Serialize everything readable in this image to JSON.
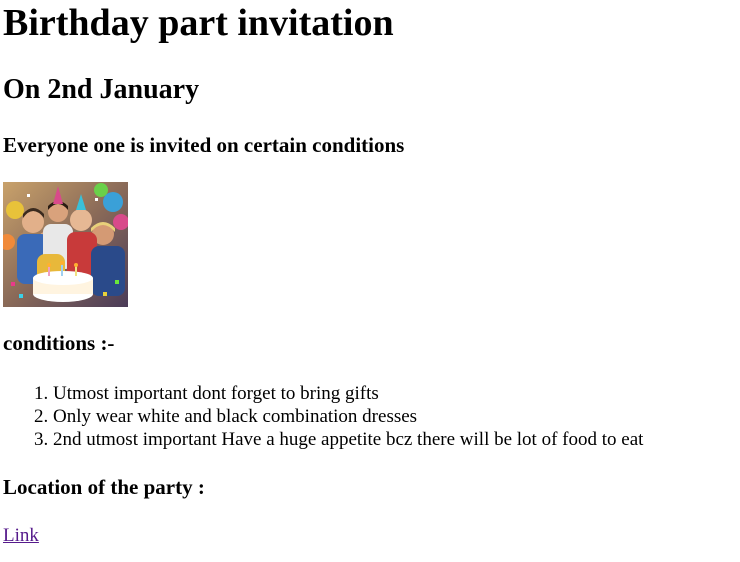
{
  "page": {
    "title": "Birthday part invitation",
    "date_heading": "On 2nd January",
    "subtitle": "Everyone one is invited on certain conditions"
  },
  "image": {
    "description_icon": "party-photo-icon"
  },
  "conditions": {
    "heading": "conditions :-",
    "items": [
      "Utmost important dont forget to bring gifts",
      "Only wear white and black combination dresses",
      "2nd utmost important Have a huge appetite bcz there will be lot of food to eat"
    ]
  },
  "location": {
    "heading": "Location of the party :",
    "link_label": "Link"
  },
  "colors": {
    "link_visited": "#551a8b",
    "text": "#000000",
    "background": "#ffffff"
  }
}
